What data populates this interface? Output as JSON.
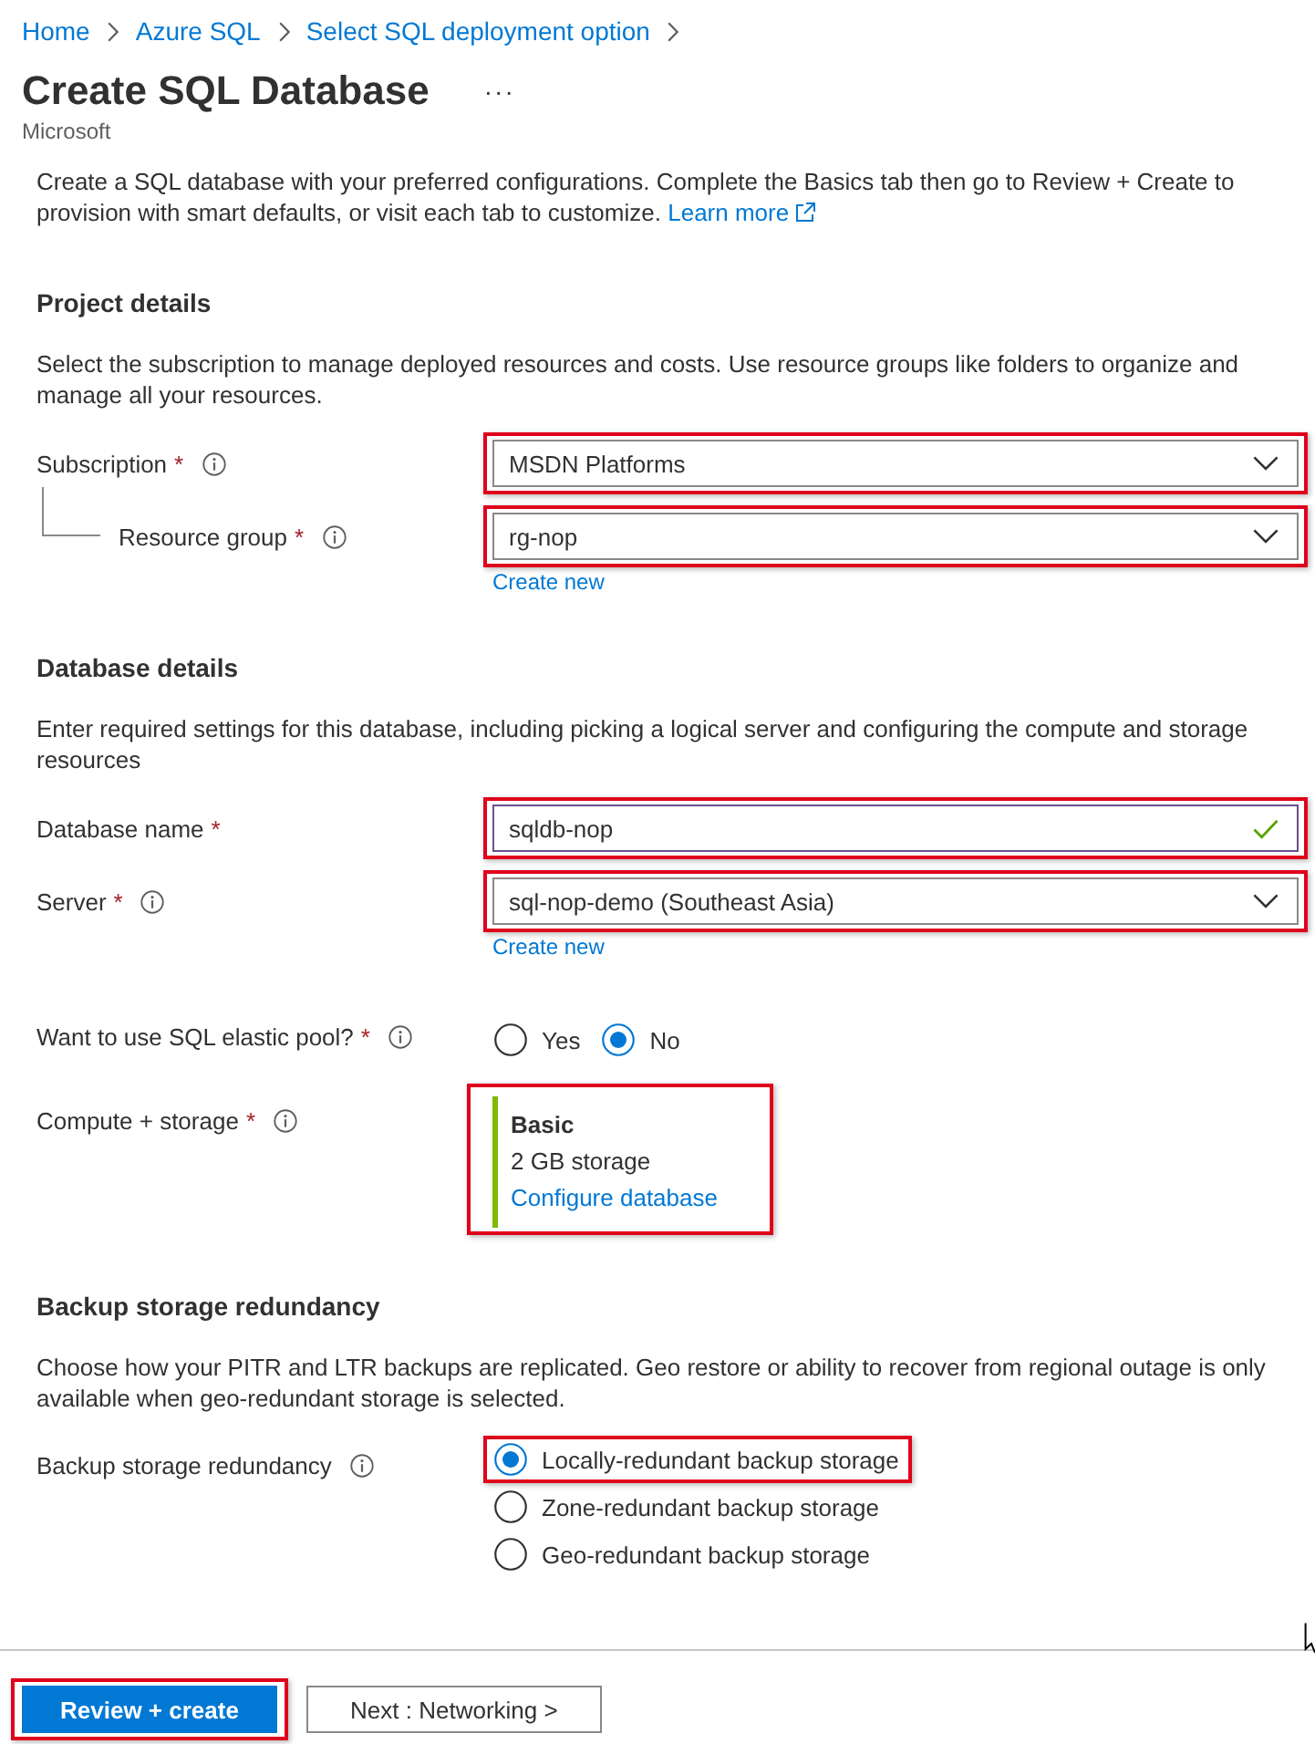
{
  "breadcrumb": [
    {
      "label": "Home"
    },
    {
      "label": "Azure SQL"
    },
    {
      "label": "Select SQL deployment option"
    }
  ],
  "header": {
    "title": "Create SQL Database",
    "more": "···",
    "publisher": "Microsoft"
  },
  "intro": {
    "text": "Create a SQL database with your preferred configurations. Complete the Basics tab then go to Review + Create to provision with smart defaults, or visit each tab to customize.",
    "link": "Learn more"
  },
  "sections": [
    {
      "heading": "Project details",
      "description": "Select the subscription to manage deployed resources and costs. Use resource groups like folders to organize and manage all your resources.",
      "fields": [
        {
          "kind": "dropdown",
          "label": "Subscription",
          "required_mark": "*",
          "info": true,
          "value": "MSDN Platforms",
          "highlighted": true,
          "children": [
            {
              "kind": "dropdown",
              "label": "Resource group",
              "required_mark": "*",
              "info": true,
              "value": "rg-nop",
              "highlighted": true,
              "link": "Create new"
            }
          ]
        }
      ]
    },
    {
      "heading": "Database details",
      "description": "Enter required settings for this database, including picking a logical server and configuring the compute and storage resources",
      "fields": [
        {
          "kind": "textbox",
          "label": "Database name",
          "required_mark": "*",
          "info": false,
          "value": "sqldb-nop",
          "valid": true,
          "highlighted": true
        },
        {
          "kind": "dropdown",
          "label": "Server",
          "required_mark": "*",
          "info": true,
          "value": "sql-nop-demo (Southeast Asia)",
          "highlighted": true,
          "link": "Create new"
        },
        {
          "kind": "radio-inline",
          "label": "Want to use SQL elastic pool?",
          "required_mark": "*",
          "info": true,
          "highlighted": false,
          "options": [
            {
              "label": "Yes",
              "selected": false
            },
            {
              "label": "No",
              "selected": true
            }
          ]
        },
        {
          "kind": "summary",
          "label": "Compute + storage",
          "required_mark": "*",
          "info": true,
          "title": "Basic",
          "detail": "2 GB storage",
          "link": "Configure database",
          "highlighted": true
        }
      ]
    },
    {
      "heading": "Backup storage redundancy",
      "description": "Choose how your PITR and LTR backups are replicated. Geo restore or ability to recover from regional outage is only available when geo-redundant storage is selected.",
      "fields": [
        {
          "kind": "radio-list",
          "label": "Backup storage redundancy",
          "info": true,
          "options": [
            {
              "label": "Locally-redundant backup storage",
              "selected": true,
              "highlighted": true
            },
            {
              "label": "Zone-redundant backup storage",
              "selected": false,
              "highlighted": false
            },
            {
              "label": "Geo-redundant backup storage",
              "selected": false,
              "highlighted": false
            }
          ]
        }
      ]
    }
  ],
  "footer": {
    "buttons": [
      {
        "label": "Review + create",
        "kind": "primary",
        "highlighted": true
      },
      {
        "label": "Next : Networking >",
        "kind": "secondary",
        "highlighted": false
      }
    ]
  }
}
